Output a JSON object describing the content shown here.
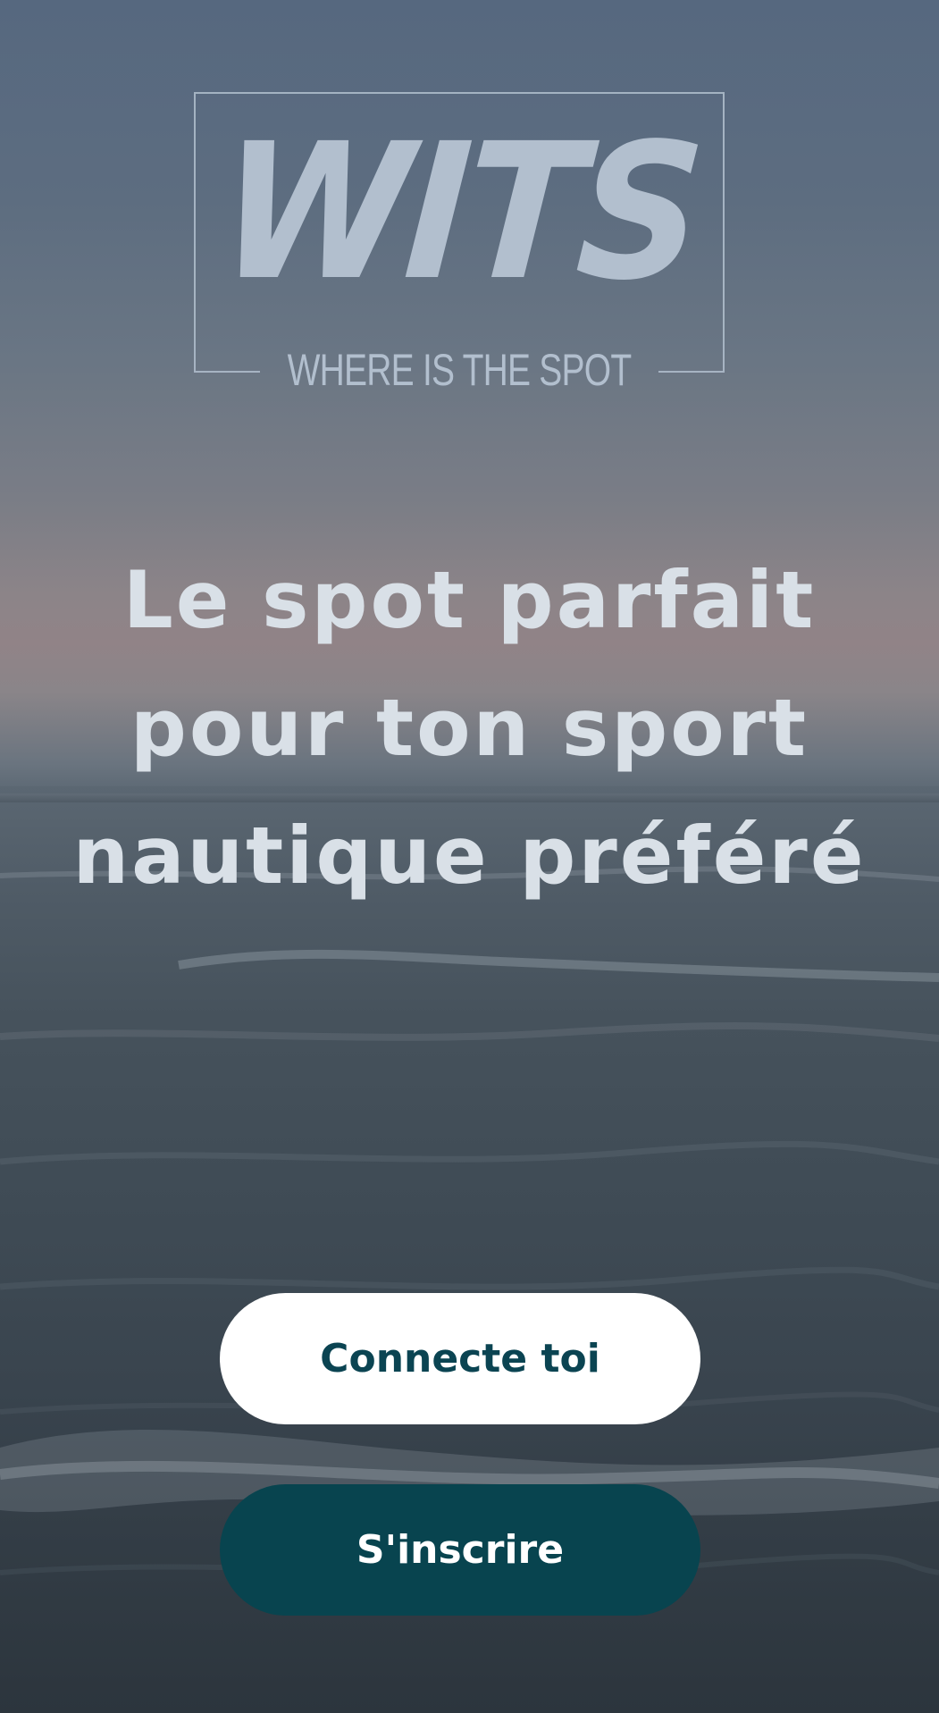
{
  "logo": {
    "word": "WITS",
    "tagline": "WHERE IS THE SPOT"
  },
  "headline": "Le spot parfait pour ton sport nautique préféré",
  "buttons": {
    "login_label": "Connecte toi",
    "signup_label": "S'inscrire"
  },
  "colors": {
    "logo": "#b2bfce",
    "headline": "#d9e0e7",
    "login_bg": "#ffffff",
    "login_text": "#0b4452",
    "signup_bg": "#08444f",
    "signup_text": "#ffffff"
  }
}
